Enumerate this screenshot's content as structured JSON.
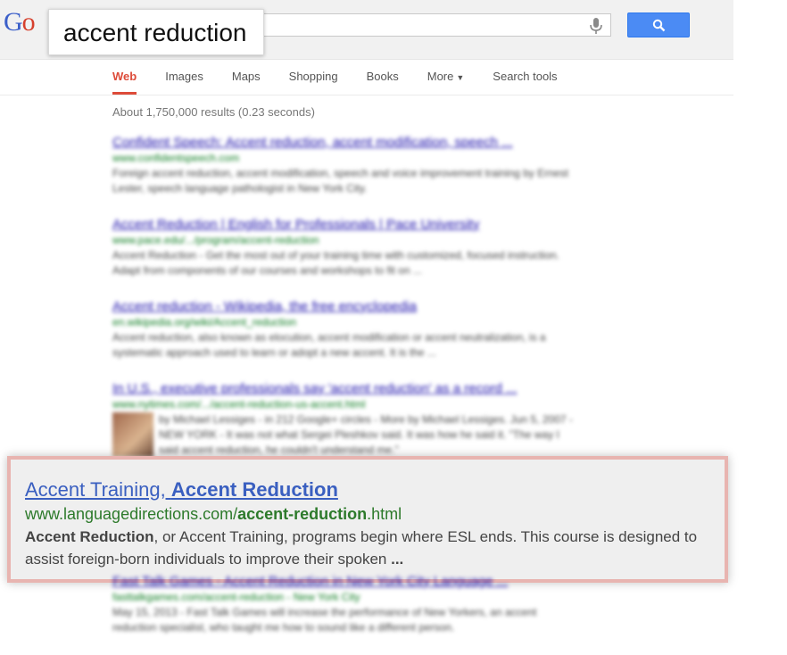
{
  "logo": {
    "g1": "G",
    "g2": "o"
  },
  "search": {
    "query": "accent reduction"
  },
  "tabs": [
    {
      "label": "Web"
    },
    {
      "label": "Images"
    },
    {
      "label": "Maps"
    },
    {
      "label": "Shopping"
    },
    {
      "label": "Books"
    },
    {
      "label": "More"
    },
    {
      "label": "Search tools"
    }
  ],
  "stats": "About 1,750,000 results (0.23 seconds)",
  "blurred_results": [
    {
      "title": "Confident Speech: Accent reduction, accent modification, speech ...",
      "url": "www.confidentspeech.com",
      "snippet": "Foreign accent reduction, accent modification, speech and voice improvement training by Ernest Lester, speech language pathologist in New York City."
    },
    {
      "title": "Accent Reduction | English for Professionals | Pace University",
      "url": "www.pace.edu/.../program/accent-reduction",
      "snippet": "Accent Reduction - Get the most out of your training time with customized, focused instruction. Adapt from components of our courses and workshops to fit on ..."
    },
    {
      "title": "Accent reduction - Wikipedia, the free encyclopedia",
      "url": "en.wikipedia.org/wiki/Accent_reduction",
      "snippet": "Accent reduction, also known as elocution, accent modification or accent neutralization, is a systematic approach used to learn or adopt a new accent. It is the ..."
    },
    {
      "title": "In U.S., executive professionals say 'accent reduction' as a record ...",
      "url": "www.nytimes.com/.../accent-reduction-us-accent.html",
      "snippet": "by Michael Lessiges - in 212 Google+ circles - More by Michael Lessiges. Jun 5, 2007 - NEW YORK - It was not what Sergei Pleshkov said. It was how he said it. \"The way I said accent reduction, he couldn't understand me.\""
    }
  ],
  "zoom_result": {
    "title_a": "Accent Training, ",
    "title_b": "Accent Reduction",
    "url_a": "www.languagedirections.com/",
    "url_b": "accent-reduction",
    "url_c": ".html",
    "snippet_a": "Accent Reduction",
    "snippet_b": ", or Accent Training, programs begin where ESL ends. This course is designed to assist foreign-born individuals to improve their spoken ",
    "snippet_c": "..."
  },
  "below_result": {
    "title": "Fast Talk Games - Accent Reduction in New York City Language ...",
    "url": "fasttalkgames.com/accent-reduction - New York City",
    "snippet": "May 15, 2013 - Fast Talk Games will increase the performance of New Yorkers, an accent reduction specialist, who taught me how to sound like a different person."
  }
}
